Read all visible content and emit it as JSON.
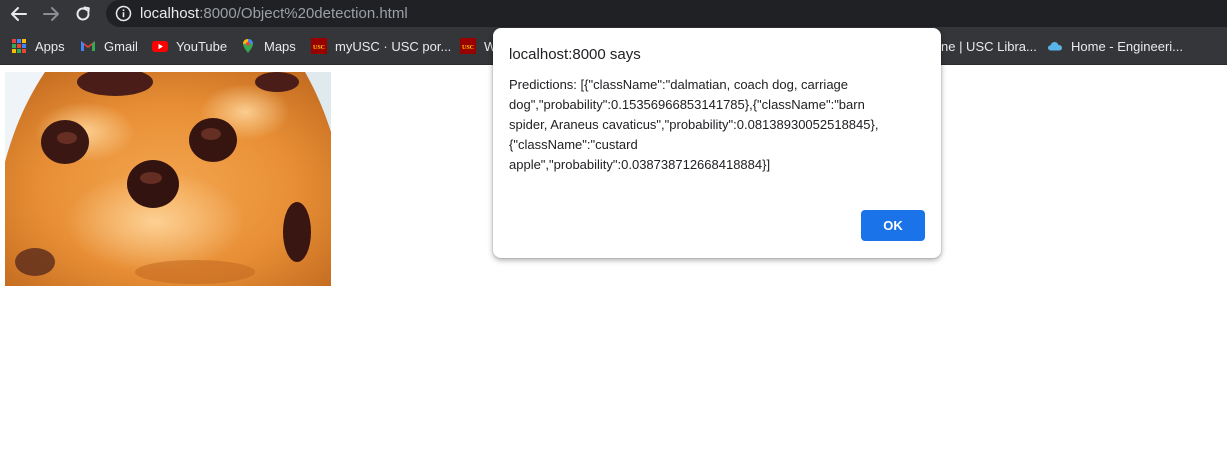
{
  "browser": {
    "url_host": "localhost",
    "url_rest": ":8000/Object%20detection.html"
  },
  "bookmarks": [
    {
      "label": "Apps",
      "icon": "apps-grid-icon"
    },
    {
      "label": "Gmail",
      "icon": "gmail-icon"
    },
    {
      "label": "YouTube",
      "icon": "youtube-icon"
    },
    {
      "label": "Maps",
      "icon": "maps-icon"
    },
    {
      "label": "myUSC · USC por...",
      "icon": "usc-icon"
    },
    {
      "label": "W",
      "icon": "usc-icon"
    },
    {
      "label": "ne | USC Libra...",
      "icon": ""
    },
    {
      "label": "Home - Engineeri...",
      "icon": "cloud-icon"
    }
  ],
  "dialog": {
    "title": "localhost:8000 says",
    "message_lines": [
      "Predictions: [{\"className\":\"dalmatian, coach dog, carriage",
      "dog\",\"probability\":0.15356966853141785},{\"className\":\"barn",
      "spider, Araneus cavaticus\",\"probability\":0.08138930052518845},",
      "{\"className\":\"custard",
      "apple\",\"probability\":0.038738712668418884}]"
    ],
    "ok_label": "OK"
  },
  "colors": {
    "toolbar": "#35363a",
    "omnibox": "#202124",
    "accent": "#1a73e8"
  }
}
